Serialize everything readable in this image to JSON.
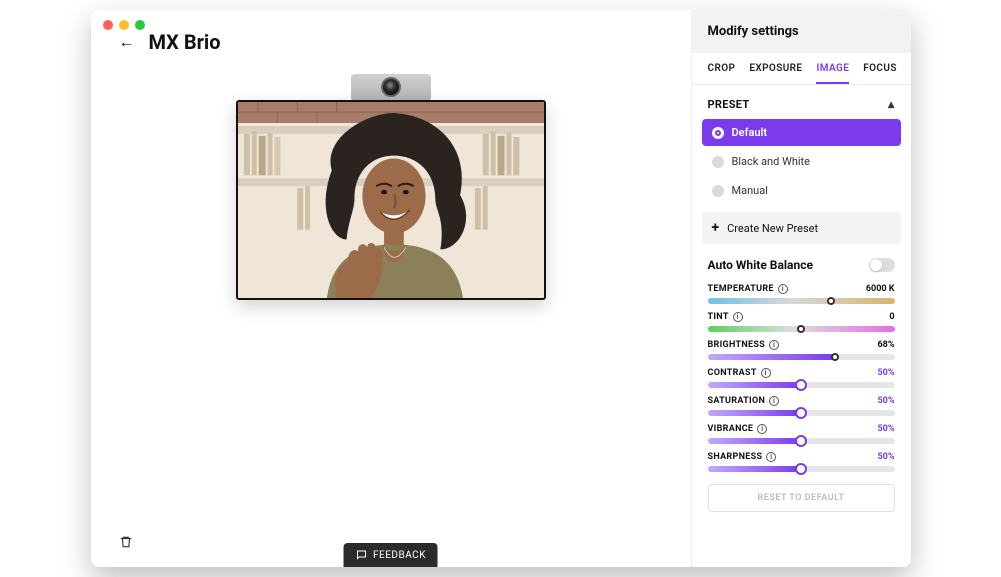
{
  "header": {
    "title": "MX Brio"
  },
  "feedback_label": "FEEDBACK",
  "panel": {
    "title": "Modify settings",
    "tabs": [
      {
        "label": "CROP",
        "active": false
      },
      {
        "label": "EXPOSURE",
        "active": false
      },
      {
        "label": "IMAGE",
        "active": true
      },
      {
        "label": "FOCUS",
        "active": false
      }
    ],
    "preset_section_label": "PRESET",
    "presets": [
      {
        "label": "Default",
        "selected": true
      },
      {
        "label": "Black and White",
        "selected": false
      },
      {
        "label": "Manual",
        "selected": false
      }
    ],
    "create_preset_label": "Create New Preset",
    "awb_label": "Auto White Balance",
    "awb_on": false,
    "sliders": {
      "temperature": {
        "label": "TEMPERATURE",
        "value_text": "6000 K",
        "pct": 66
      },
      "tint": {
        "label": "TINT",
        "value_text": "0",
        "pct": 50
      },
      "brightness": {
        "label": "BRIGHTNESS",
        "value_text": "68%",
        "pct": 68
      },
      "contrast": {
        "label": "CONTRAST",
        "value_text": "50%",
        "pct": 50
      },
      "saturation": {
        "label": "SATURATION",
        "value_text": "50%",
        "pct": 50
      },
      "vibrance": {
        "label": "VIBRANCE",
        "value_text": "50%",
        "pct": 50
      },
      "sharpness": {
        "label": "SHARPNESS",
        "value_text": "50%",
        "pct": 50
      }
    },
    "reset_label": "RESET TO DEFAULT"
  }
}
